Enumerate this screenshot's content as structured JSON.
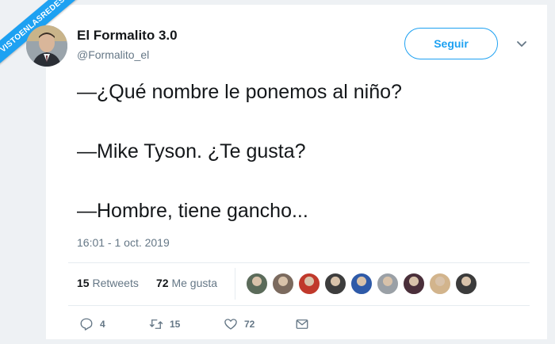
{
  "watermark": "VISTOENLASREDES",
  "author": {
    "name": "El Formalito 3.0",
    "handle": "@Formalito_el",
    "avatar_icon": "profile-photo"
  },
  "follow_button": "Seguir",
  "menu_icon": "chevron-down-icon",
  "tweet": {
    "lines": [
      "—¿Qué nombre le ponemos al niño?",
      "—Mike Tyson. ¿Te gusta?",
      "—Hombre, tiene gancho..."
    ],
    "timestamp": "16:01 - 1 oct. 2019"
  },
  "stats": {
    "retweets_count": "15",
    "retweets_label": "Retweets",
    "likes_count": "72",
    "likes_label": "Me gusta"
  },
  "liker_avatars": [
    "#5b6b5a",
    "#7b6a5e",
    "#c0392b",
    "#3d3d3d",
    "#2e5aa8",
    "#9aa0a6",
    "#4a2f3a",
    "#d2b48c",
    "#3b3b3b"
  ],
  "actions": {
    "reply_count": "4",
    "retweet_count": "15",
    "like_count": "72"
  },
  "colors": {
    "accent": "#1da1f2",
    "text": "#14171a",
    "muted": "#657786"
  }
}
